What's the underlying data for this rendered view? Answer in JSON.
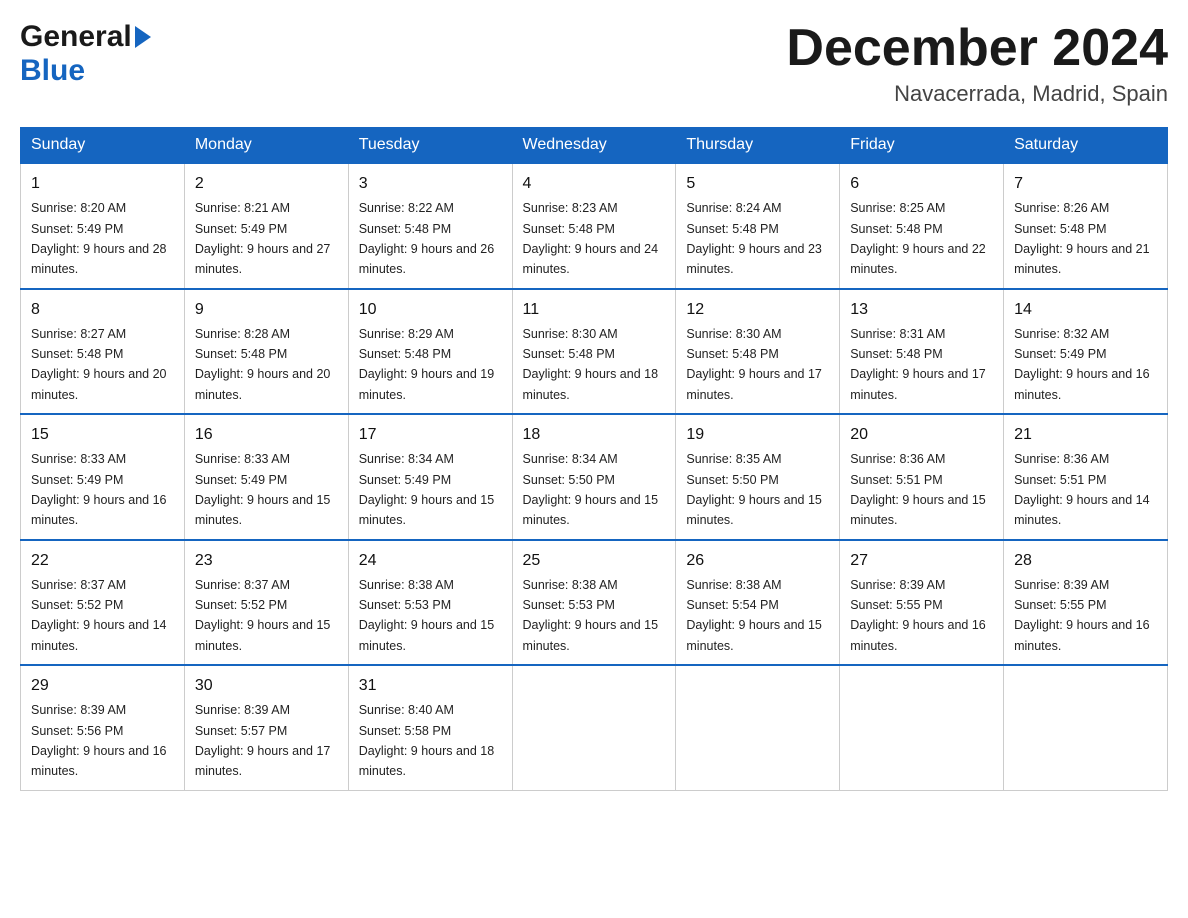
{
  "header": {
    "logo_general": "General",
    "logo_blue": "Blue",
    "month_title": "December 2024",
    "location": "Navacerrada, Madrid, Spain"
  },
  "days_of_week": [
    "Sunday",
    "Monday",
    "Tuesday",
    "Wednesday",
    "Thursday",
    "Friday",
    "Saturday"
  ],
  "weeks": [
    [
      {
        "day": "1",
        "sunrise": "8:20 AM",
        "sunset": "5:49 PM",
        "daylight": "9 hours and 28 minutes."
      },
      {
        "day": "2",
        "sunrise": "8:21 AM",
        "sunset": "5:49 PM",
        "daylight": "9 hours and 27 minutes."
      },
      {
        "day": "3",
        "sunrise": "8:22 AM",
        "sunset": "5:48 PM",
        "daylight": "9 hours and 26 minutes."
      },
      {
        "day": "4",
        "sunrise": "8:23 AM",
        "sunset": "5:48 PM",
        "daylight": "9 hours and 24 minutes."
      },
      {
        "day": "5",
        "sunrise": "8:24 AM",
        "sunset": "5:48 PM",
        "daylight": "9 hours and 23 minutes."
      },
      {
        "day": "6",
        "sunrise": "8:25 AM",
        "sunset": "5:48 PM",
        "daylight": "9 hours and 22 minutes."
      },
      {
        "day": "7",
        "sunrise": "8:26 AM",
        "sunset": "5:48 PM",
        "daylight": "9 hours and 21 minutes."
      }
    ],
    [
      {
        "day": "8",
        "sunrise": "8:27 AM",
        "sunset": "5:48 PM",
        "daylight": "9 hours and 20 minutes."
      },
      {
        "day": "9",
        "sunrise": "8:28 AM",
        "sunset": "5:48 PM",
        "daylight": "9 hours and 20 minutes."
      },
      {
        "day": "10",
        "sunrise": "8:29 AM",
        "sunset": "5:48 PM",
        "daylight": "9 hours and 19 minutes."
      },
      {
        "day": "11",
        "sunrise": "8:30 AM",
        "sunset": "5:48 PM",
        "daylight": "9 hours and 18 minutes."
      },
      {
        "day": "12",
        "sunrise": "8:30 AM",
        "sunset": "5:48 PM",
        "daylight": "9 hours and 17 minutes."
      },
      {
        "day": "13",
        "sunrise": "8:31 AM",
        "sunset": "5:48 PM",
        "daylight": "9 hours and 17 minutes."
      },
      {
        "day": "14",
        "sunrise": "8:32 AM",
        "sunset": "5:49 PM",
        "daylight": "9 hours and 16 minutes."
      }
    ],
    [
      {
        "day": "15",
        "sunrise": "8:33 AM",
        "sunset": "5:49 PM",
        "daylight": "9 hours and 16 minutes."
      },
      {
        "day": "16",
        "sunrise": "8:33 AM",
        "sunset": "5:49 PM",
        "daylight": "9 hours and 15 minutes."
      },
      {
        "day": "17",
        "sunrise": "8:34 AM",
        "sunset": "5:49 PM",
        "daylight": "9 hours and 15 minutes."
      },
      {
        "day": "18",
        "sunrise": "8:34 AM",
        "sunset": "5:50 PM",
        "daylight": "9 hours and 15 minutes."
      },
      {
        "day": "19",
        "sunrise": "8:35 AM",
        "sunset": "5:50 PM",
        "daylight": "9 hours and 15 minutes."
      },
      {
        "day": "20",
        "sunrise": "8:36 AM",
        "sunset": "5:51 PM",
        "daylight": "9 hours and 15 minutes."
      },
      {
        "day": "21",
        "sunrise": "8:36 AM",
        "sunset": "5:51 PM",
        "daylight": "9 hours and 14 minutes."
      }
    ],
    [
      {
        "day": "22",
        "sunrise": "8:37 AM",
        "sunset": "5:52 PM",
        "daylight": "9 hours and 14 minutes."
      },
      {
        "day": "23",
        "sunrise": "8:37 AM",
        "sunset": "5:52 PM",
        "daylight": "9 hours and 15 minutes."
      },
      {
        "day": "24",
        "sunrise": "8:38 AM",
        "sunset": "5:53 PM",
        "daylight": "9 hours and 15 minutes."
      },
      {
        "day": "25",
        "sunrise": "8:38 AM",
        "sunset": "5:53 PM",
        "daylight": "9 hours and 15 minutes."
      },
      {
        "day": "26",
        "sunrise": "8:38 AM",
        "sunset": "5:54 PM",
        "daylight": "9 hours and 15 minutes."
      },
      {
        "day": "27",
        "sunrise": "8:39 AM",
        "sunset": "5:55 PM",
        "daylight": "9 hours and 16 minutes."
      },
      {
        "day": "28",
        "sunrise": "8:39 AM",
        "sunset": "5:55 PM",
        "daylight": "9 hours and 16 minutes."
      }
    ],
    [
      {
        "day": "29",
        "sunrise": "8:39 AM",
        "sunset": "5:56 PM",
        "daylight": "9 hours and 16 minutes."
      },
      {
        "day": "30",
        "sunrise": "8:39 AM",
        "sunset": "5:57 PM",
        "daylight": "9 hours and 17 minutes."
      },
      {
        "day": "31",
        "sunrise": "8:40 AM",
        "sunset": "5:58 PM",
        "daylight": "9 hours and 18 minutes."
      },
      null,
      null,
      null,
      null
    ]
  ]
}
